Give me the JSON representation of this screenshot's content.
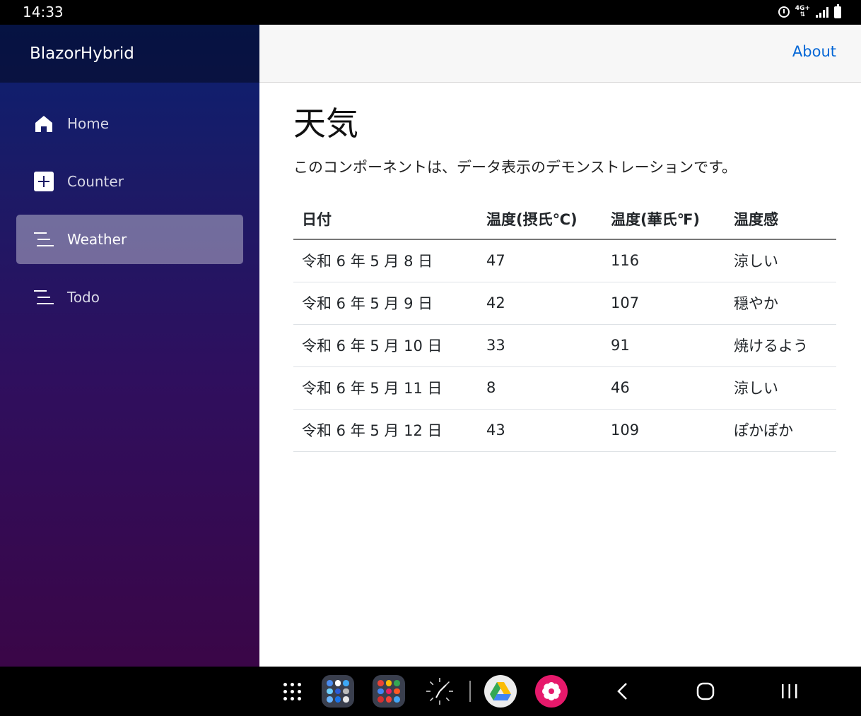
{
  "status_bar": {
    "time": "14:33",
    "network": "4G+",
    "icons": [
      "alarm-icon",
      "network-4g-icon",
      "signal-icon",
      "battery-icon"
    ]
  },
  "sidebar": {
    "brand": "BlazorHybrid",
    "items": [
      {
        "label": "Home",
        "icon": "home-icon",
        "active": false
      },
      {
        "label": "Counter",
        "icon": "plus-square-icon",
        "active": false
      },
      {
        "label": "Weather",
        "icon": "list-icon",
        "active": true
      },
      {
        "label": "Todo",
        "icon": "list-icon",
        "active": false
      }
    ]
  },
  "topbar": {
    "about_label": "About"
  },
  "page": {
    "title": "天気",
    "description": "このコンポーネントは、データ表示のデモンストレーションです。"
  },
  "table": {
    "headers": [
      "日付",
      "温度(摂氏℃)",
      "温度(華氏℉)",
      "温度感"
    ],
    "rows": [
      [
        "令和 6 年 5 月 8 日",
        "47",
        "116",
        "涼しい"
      ],
      [
        "令和 6 年 5 月 9 日",
        "42",
        "107",
        "穏やか"
      ],
      [
        "令和 6 年 5 月 10 日",
        "33",
        "91",
        "焼けるよう"
      ],
      [
        "令和 6 年 5 月 11 日",
        "8",
        "46",
        "涼しい"
      ],
      [
        "令和 6 年 5 月 12 日",
        "43",
        "109",
        "ぽかぽか"
      ]
    ]
  },
  "android_nav": {
    "apps": [
      "app-drawer-icon",
      "app-folder-1",
      "app-folder-2",
      "clock-app-icon",
      "google-drive-icon",
      "flower-app-icon"
    ],
    "buttons": [
      "back-button",
      "home-button",
      "recents-button"
    ]
  },
  "colors": {
    "link": "#0366d6",
    "sidebar_top": "#0a2070",
    "sidebar_bottom": "#3a0647",
    "active_item": "rgba(255,255,255,0.37)"
  }
}
